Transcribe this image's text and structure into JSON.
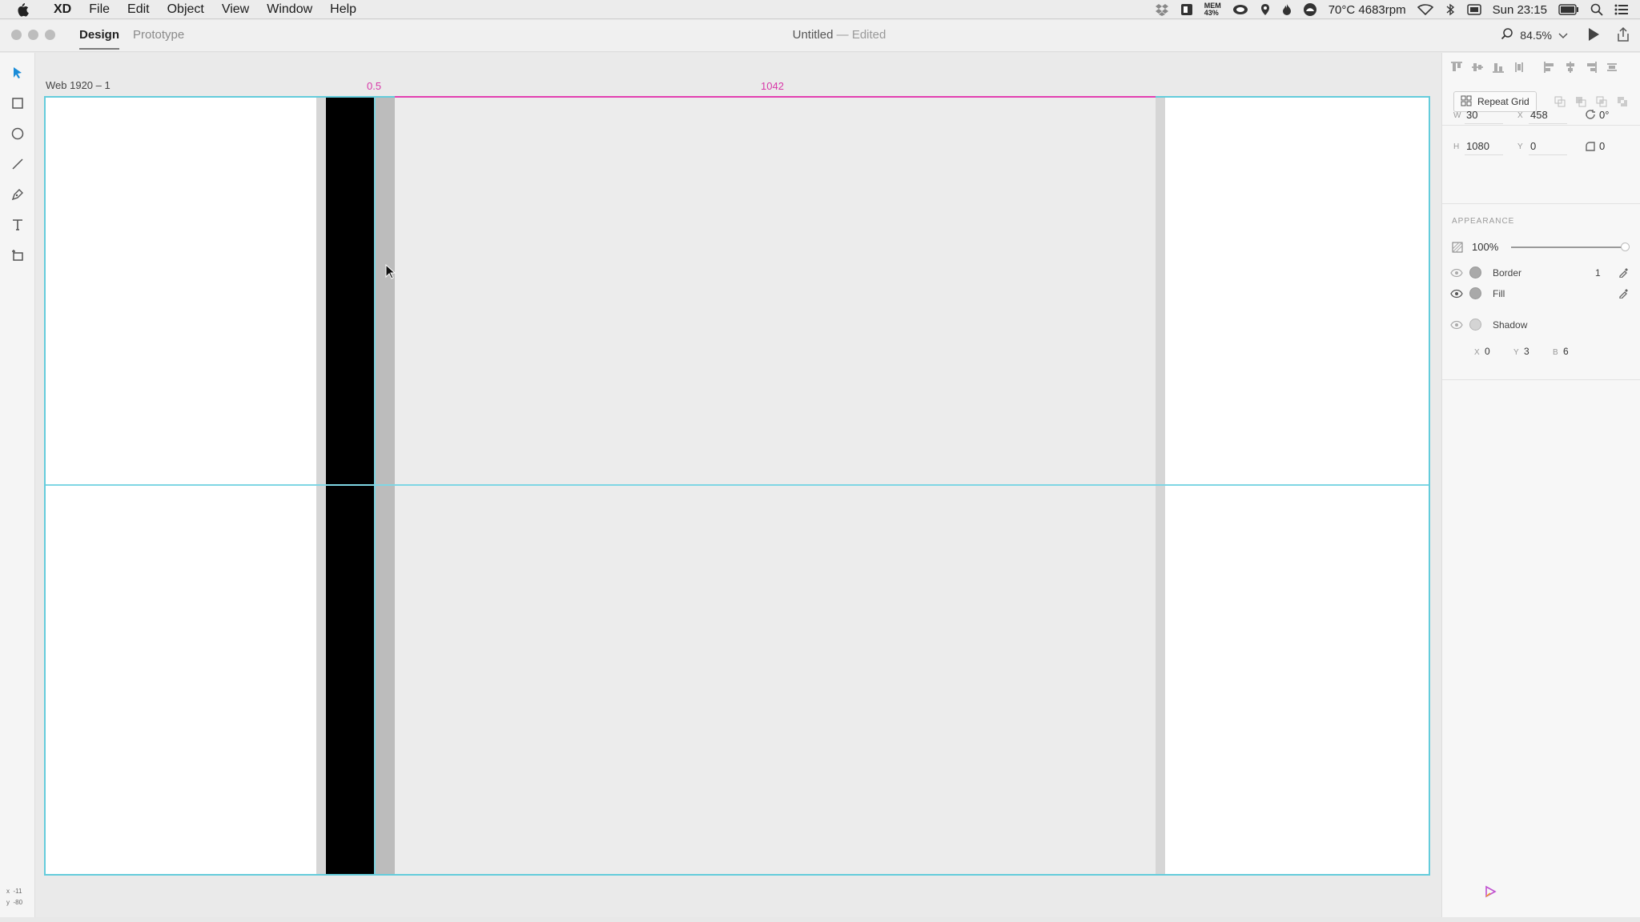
{
  "menubar": {
    "items": [
      "XD",
      "File",
      "Edit",
      "Object",
      "View",
      "Window",
      "Help"
    ],
    "status": {
      "mem_label": "MEM",
      "mem_value": "43%",
      "temp": "70°C 4683rpm",
      "clock": "Sun 23:15"
    }
  },
  "titlebar": {
    "tabs": [
      "Design",
      "Prototype"
    ],
    "doc_name": "Untitled",
    "doc_sep": " — ",
    "doc_state": "Edited",
    "zoom": "84.5%"
  },
  "canvas": {
    "artboard_name": "Web 1920 – 1",
    "measure_left": "0.5",
    "measure_right": "1042"
  },
  "coords": {
    "x": "-11",
    "y": "-80"
  },
  "inspector": {
    "repeat_grid": "Repeat Grid",
    "w_label": "W",
    "w": "30",
    "x_label": "X",
    "x": "458",
    "rotation": "0°",
    "h_label": "H",
    "h": "1080",
    "y_label": "Y",
    "y": "0",
    "radius": "0",
    "appearance": "APPEARANCE",
    "opacity": "100%",
    "opacity_value": 1.0,
    "border_label": "Border",
    "border_width": "1",
    "fill_label": "Fill",
    "shadow_label": "Shadow",
    "shadow_x_label": "X",
    "shadow_x": "0",
    "shadow_y_label": "Y",
    "shadow_y": "3",
    "shadow_b_label": "B",
    "shadow_b": "6"
  },
  "colors": {
    "guide": "#64ccdb",
    "measure": "#d838a8",
    "selection_accent": "#1a8cd8"
  }
}
